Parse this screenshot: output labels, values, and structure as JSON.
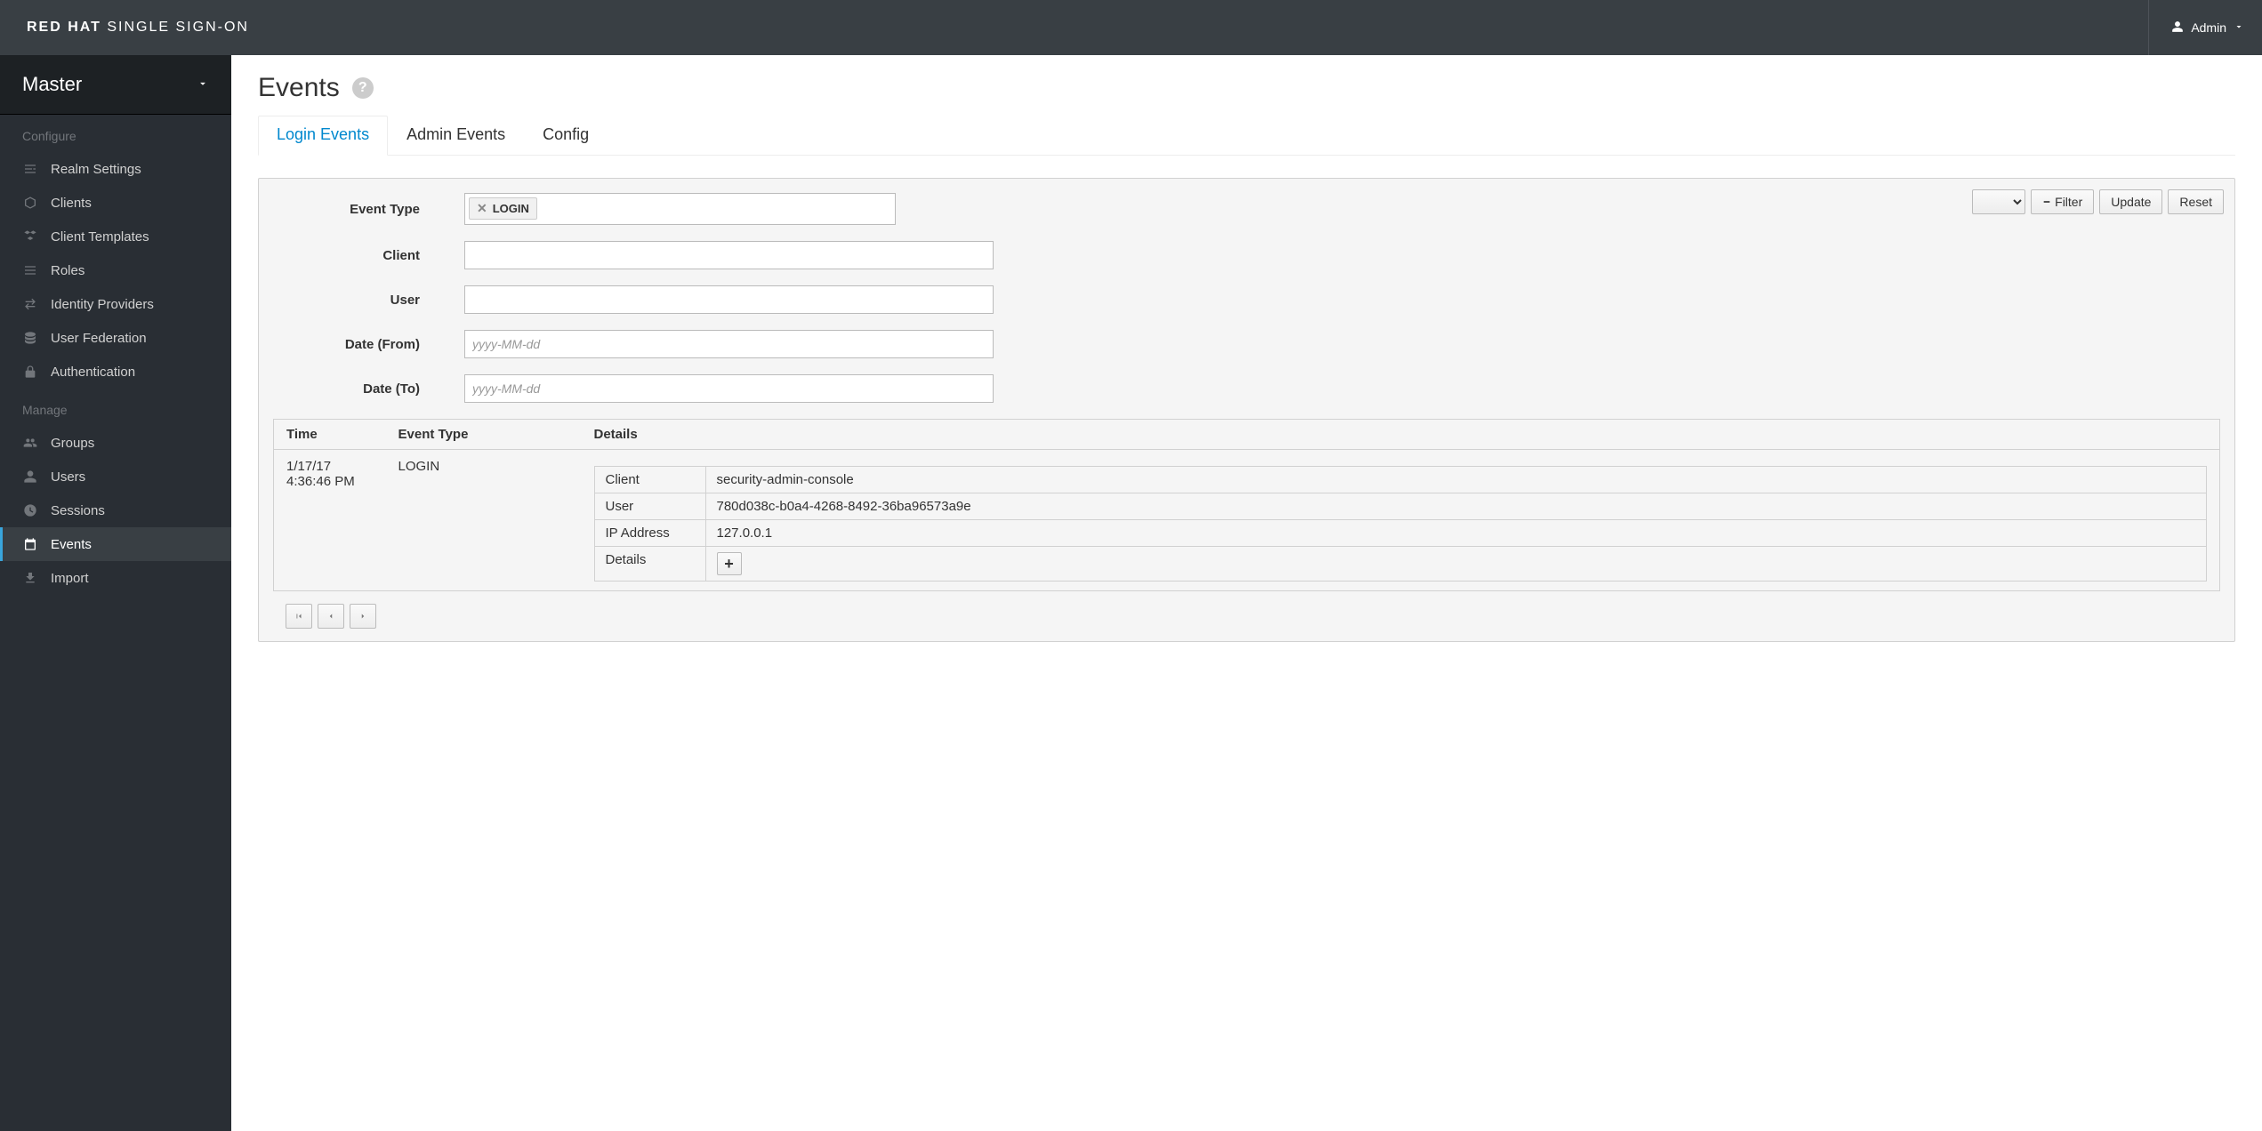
{
  "brand": {
    "strong": "RED HAT",
    "light": "SINGLE SIGN-ON"
  },
  "user": {
    "label": "Admin"
  },
  "realm": {
    "name": "Master"
  },
  "sidebar": {
    "sections": {
      "configure": {
        "title": "Configure"
      },
      "manage": {
        "title": "Manage"
      }
    },
    "items": {
      "realm_settings": "Realm Settings",
      "clients": "Clients",
      "client_templates": "Client Templates",
      "roles": "Roles",
      "identity_providers": "Identity Providers",
      "user_federation": "User Federation",
      "authentication": "Authentication",
      "groups": "Groups",
      "users": "Users",
      "sessions": "Sessions",
      "events": "Events",
      "import": "Import"
    }
  },
  "page": {
    "title": "Events"
  },
  "tabs": {
    "login_events": "Login Events",
    "admin_events": "Admin Events",
    "config": "Config"
  },
  "filter": {
    "labels": {
      "event_type": "Event Type",
      "client": "Client",
      "user": "User",
      "date_from": "Date (From)",
      "date_to": "Date (To)"
    },
    "values": {
      "event_type_token": "LOGIN",
      "client": "",
      "user": "",
      "date_from": "",
      "date_to": ""
    },
    "placeholders": {
      "date": "yyyy-MM-dd"
    }
  },
  "actions": {
    "filter": "Filter",
    "update": "Update",
    "reset": "Reset"
  },
  "table": {
    "headers": {
      "time": "Time",
      "event_type": "Event Type",
      "details": "Details"
    },
    "row": {
      "time_date": "1/17/17",
      "time_time": "4:36:46 PM",
      "event_type": "LOGIN",
      "details_keys": {
        "client": "Client",
        "user": "User",
        "ip": "IP Address",
        "details": "Details"
      },
      "details_values": {
        "client": "security-admin-console",
        "user": "780d038c-b0a4-4268-8492-36ba96573a9e",
        "ip": "127.0.0.1"
      }
    }
  }
}
